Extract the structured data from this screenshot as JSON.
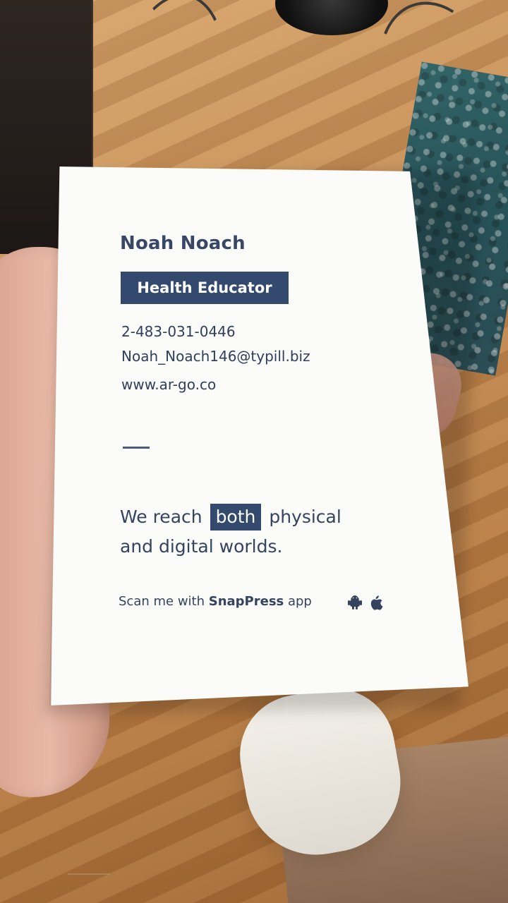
{
  "card": {
    "name": "Noah Noach",
    "title": "Health Educator",
    "phone": "2-483-031-0446",
    "email": "Noah_Noach146@typill.biz",
    "website": "www.ar-go.co",
    "tagline": {
      "prefix": "We reach",
      "highlight": "both",
      "suffix_line1": "physical",
      "line2": "and digital worlds."
    },
    "scan": {
      "text_prefix": "Scan me with ",
      "brand": "SnapPress",
      "text_suffix": " app"
    },
    "icons": [
      "android-icon",
      "apple-icon"
    ],
    "colors": {
      "accent": "#34496e",
      "text": "#34445f",
      "card": "#fbfbfa"
    }
  }
}
